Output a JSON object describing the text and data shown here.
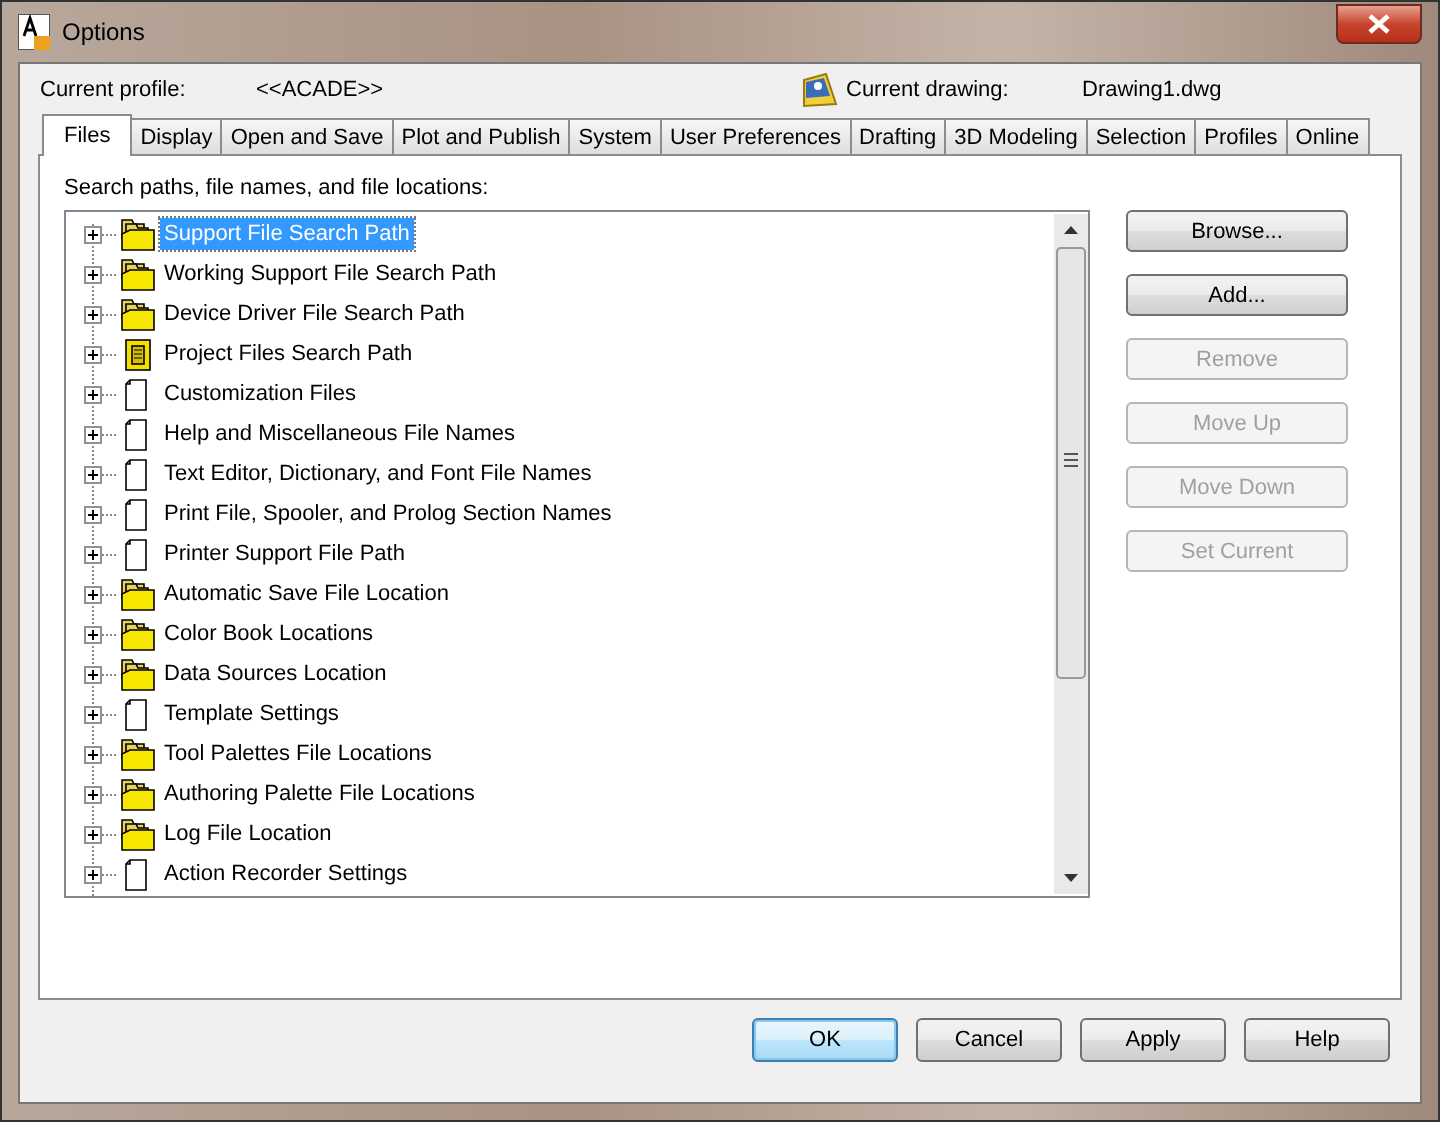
{
  "window": {
    "title": "Options"
  },
  "profile": {
    "label": "Current profile:",
    "value": "<<ACADE>>"
  },
  "drawing": {
    "label": "Current drawing:",
    "value": "Drawing1.dwg"
  },
  "tabs": [
    {
      "label": "Files",
      "selected": true
    },
    {
      "label": "Display",
      "selected": false
    },
    {
      "label": "Open and Save",
      "selected": false
    },
    {
      "label": "Plot and Publish",
      "selected": false
    },
    {
      "label": "System",
      "selected": false
    },
    {
      "label": "User Preferences",
      "selected": false
    },
    {
      "label": "Drafting",
      "selected": false
    },
    {
      "label": "3D Modeling",
      "selected": false
    },
    {
      "label": "Selection",
      "selected": false
    },
    {
      "label": "Profiles",
      "selected": false
    },
    {
      "label": "Online",
      "selected": false
    }
  ],
  "tree_label": "Search paths, file names, and file locations:",
  "tree": [
    {
      "label": "Support File Search Path",
      "kind": "folders",
      "selected": true
    },
    {
      "label": "Working Support File Search Path",
      "kind": "folders",
      "selected": false
    },
    {
      "label": "Device Driver File Search Path",
      "kind": "folders",
      "selected": false
    },
    {
      "label": "Project Files Search Path",
      "kind": "project",
      "selected": false
    },
    {
      "label": "Customization Files",
      "kind": "file",
      "selected": false
    },
    {
      "label": "Help and Miscellaneous File Names",
      "kind": "file",
      "selected": false
    },
    {
      "label": "Text Editor, Dictionary, and Font File Names",
      "kind": "file",
      "selected": false
    },
    {
      "label": "Print File, Spooler, and Prolog Section Names",
      "kind": "file",
      "selected": false
    },
    {
      "label": "Printer Support File Path",
      "kind": "file",
      "selected": false
    },
    {
      "label": "Automatic Save File Location",
      "kind": "folders",
      "selected": false
    },
    {
      "label": "Color Book Locations",
      "kind": "folders",
      "selected": false
    },
    {
      "label": "Data Sources Location",
      "kind": "folders",
      "selected": false
    },
    {
      "label": "Template Settings",
      "kind": "file",
      "selected": false
    },
    {
      "label": "Tool Palettes File Locations",
      "kind": "folders",
      "selected": false
    },
    {
      "label": "Authoring Palette File Locations",
      "kind": "folders",
      "selected": false
    },
    {
      "label": "Log File Location",
      "kind": "folders",
      "selected": false
    },
    {
      "label": "Action Recorder Settings",
      "kind": "file",
      "selected": false
    }
  ],
  "side_buttons": [
    {
      "label": "Browse...",
      "disabled": false
    },
    {
      "label": "Add...",
      "disabled": false
    },
    {
      "label": "Remove",
      "disabled": true
    },
    {
      "label": "Move Up",
      "disabled": true
    },
    {
      "label": "Move Down",
      "disabled": true
    },
    {
      "label": "Set Current",
      "disabled": true
    }
  ],
  "buttons": [
    {
      "label": "OK",
      "default": true
    },
    {
      "label": "Cancel",
      "default": false
    },
    {
      "label": "Apply",
      "default": false
    },
    {
      "label": "Help",
      "default": false
    }
  ]
}
